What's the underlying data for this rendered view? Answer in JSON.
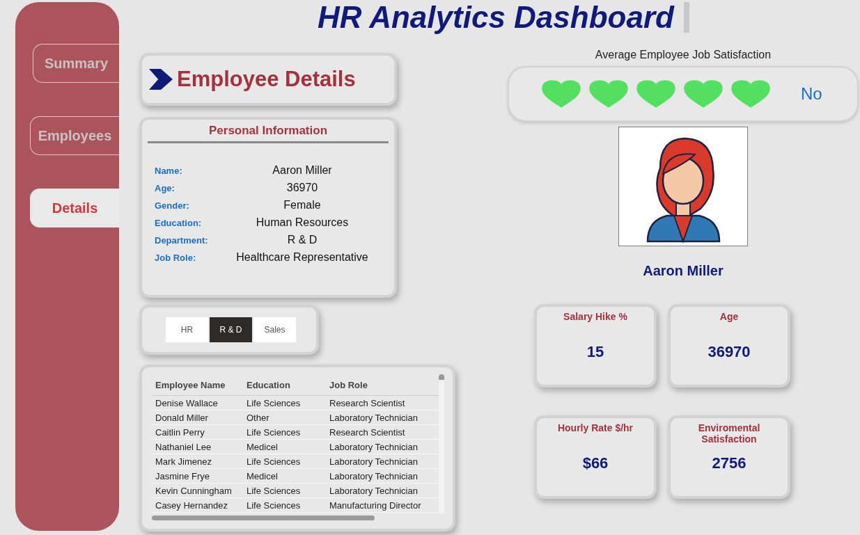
{
  "title": "HR Analytics Dashboard",
  "nav": [
    {
      "label": "Summary",
      "selected": false
    },
    {
      "label": "Employees",
      "selected": false
    },
    {
      "label": "Details",
      "selected": true
    }
  ],
  "header": {
    "title": "Employee Details"
  },
  "personal_info": {
    "title": "Personal Information",
    "fields": [
      {
        "label": "Name:",
        "value": "Aaron Miller"
      },
      {
        "label": "Age:",
        "value": "36970"
      },
      {
        "label": "Gender:",
        "value": "Female"
      },
      {
        "label": "Education:",
        "value": "Human Resources"
      },
      {
        "label": "Department:",
        "value": "R & D"
      },
      {
        "label": "Job Role:",
        "value": "Healthcare Representative"
      }
    ]
  },
  "department_slicer": [
    {
      "label": "HR",
      "selected": false
    },
    {
      "label": "R & D",
      "selected": true
    },
    {
      "label": "Sales",
      "selected": false
    }
  ],
  "table": {
    "columns": [
      "Employee Name",
      "Education",
      "Job Role"
    ],
    "rows": [
      [
        "Denise Wallace",
        "Life Sciences",
        "Research Scientist"
      ],
      [
        "Donald Miller",
        "Other",
        "Laboratory Technician"
      ],
      [
        "Caitlin Perry",
        "Life Sciences",
        "Research Scientist"
      ],
      [
        "Nathaniel Lee",
        "Medicel",
        "Laboratory Technician"
      ],
      [
        "Mark Jimenez",
        "Life Sciences",
        "Laboratory Technician"
      ],
      [
        "Jasmine Frye",
        "Medicel",
        "Laboratory Technician"
      ],
      [
        "Kevin Cunningham",
        "Life Sciences",
        "Laboratory Technician"
      ],
      [
        "Casey Hernandez",
        "Life Sciences",
        "Manufacturing Director"
      ]
    ]
  },
  "satisfaction": {
    "title": "Average Employee Job Satisfaction",
    "stars": 5,
    "value": "No"
  },
  "employee": {
    "name": "Aaron Miller"
  },
  "kpis": [
    {
      "title": "Salary Hike %",
      "value": "15"
    },
    {
      "title": "Age",
      "value": "36970"
    },
    {
      "title": "Hourly Rate $/hr",
      "value": "$66"
    },
    {
      "title": "Enviromental Satisfaction",
      "value": "2756"
    }
  ]
}
